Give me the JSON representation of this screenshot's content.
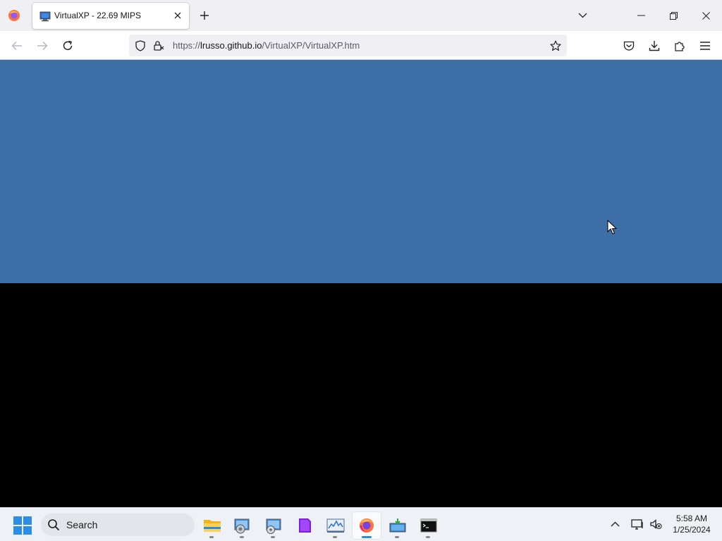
{
  "browser": {
    "tab": {
      "title": "VirtualXP - 22.69 MIPS",
      "favicon": "virtualxp-monitor-icon"
    },
    "new_tab_label": "+",
    "url": {
      "scheme": "https://",
      "host": "lrusso.github.io",
      "path": "/VirtualXP/VirtualXP.htm"
    },
    "colors": {
      "tabstrip": "#f0f0f4",
      "urlbar": "#f0f0f4",
      "accent": "#ff7139"
    }
  },
  "page": {
    "emulator_top_color": "#3d6fa6",
    "emulator_bottom_color": "#000000"
  },
  "taskbar": {
    "search_placeholder": "Search",
    "apps": [
      {
        "name": "file-explorer-icon",
        "active": false
      },
      {
        "name": "control-panel-icon",
        "active": false
      },
      {
        "name": "disk-management-icon",
        "active": false
      },
      {
        "name": "notes-app-icon",
        "active": false
      },
      {
        "name": "resource-monitor-icon",
        "active": false
      },
      {
        "name": "firefox-icon",
        "active": true
      },
      {
        "name": "media-creation-icon",
        "active": false
      },
      {
        "name": "command-prompt-icon",
        "active": false
      }
    ],
    "clock": {
      "time": "5:58 AM",
      "date": "1/25/2024"
    }
  }
}
